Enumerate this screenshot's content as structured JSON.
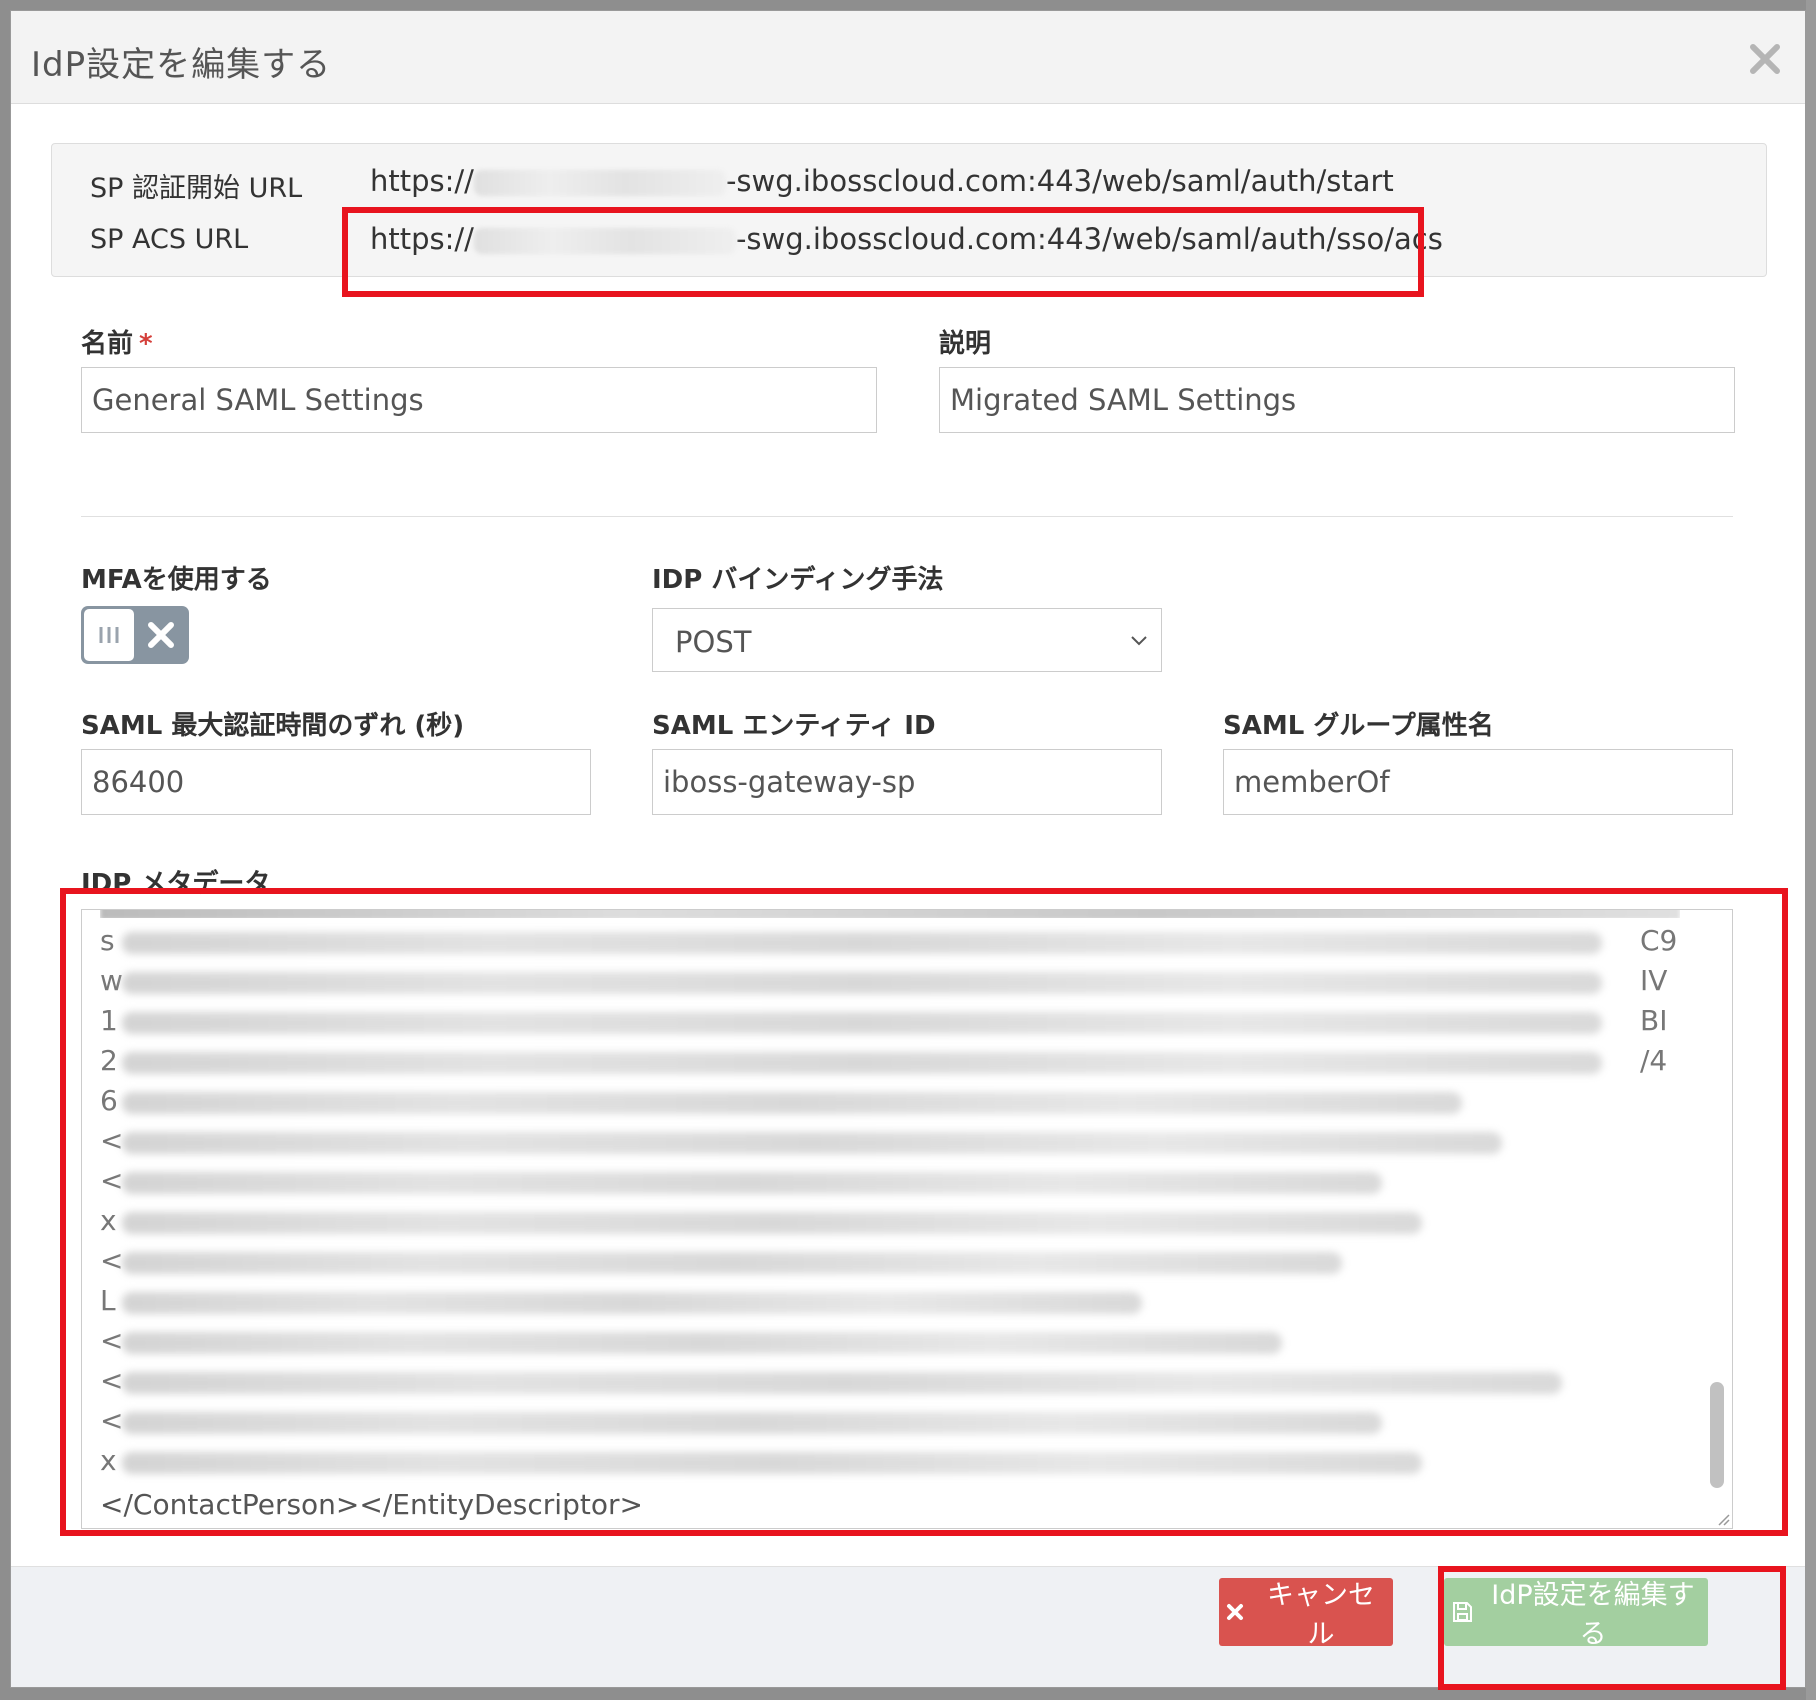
{
  "dialog": {
    "title": "IdP設定を編集する"
  },
  "sp_urls": {
    "start_label": "SP 認証開始 URL",
    "start_prefix": "https://",
    "start_suffix": "-swg.ibosscloud.com:443/web/saml/auth/start",
    "acs_label": "SP ACS URL",
    "acs_prefix": "https://",
    "acs_suffix": "-swg.ibosscloud.com:443/web/saml/auth/sso/acs"
  },
  "form": {
    "name_label": "名前",
    "name_required": "*",
    "name_value": "General SAML Settings",
    "description_label": "説明",
    "description_value": "Migrated SAML Settings",
    "mfa_label": "MFAを使用する",
    "binding_label": "IDP バインディング手法",
    "binding_value": "POST",
    "skew_label": "SAML 最大認証時間のずれ (秒)",
    "skew_value": "86400",
    "entity_label": "SAML エンティティ ID",
    "entity_value": "iboss-gateway-sp",
    "group_attr_label": "SAML グループ属性名",
    "group_attr_value": "memberOf",
    "metadata_label": "IDP メタデータ",
    "metadata_line_starts": [
      "s",
      "w",
      "1",
      "2",
      "6",
      "<",
      "<",
      "x",
      "<",
      "L",
      "<",
      "<",
      "<",
      "x"
    ],
    "metadata_line_ends": [
      "C9",
      "IV",
      "BI",
      "/4"
    ],
    "metadata_last_line": "</ContactPerson></EntityDescriptor>"
  },
  "footer": {
    "cancel_label": "キャンセル",
    "save_label": "IdP設定を編集する"
  },
  "colors": {
    "highlight": "#e8141e",
    "cancel": "#d9534f",
    "save": "#a3cfa0"
  }
}
